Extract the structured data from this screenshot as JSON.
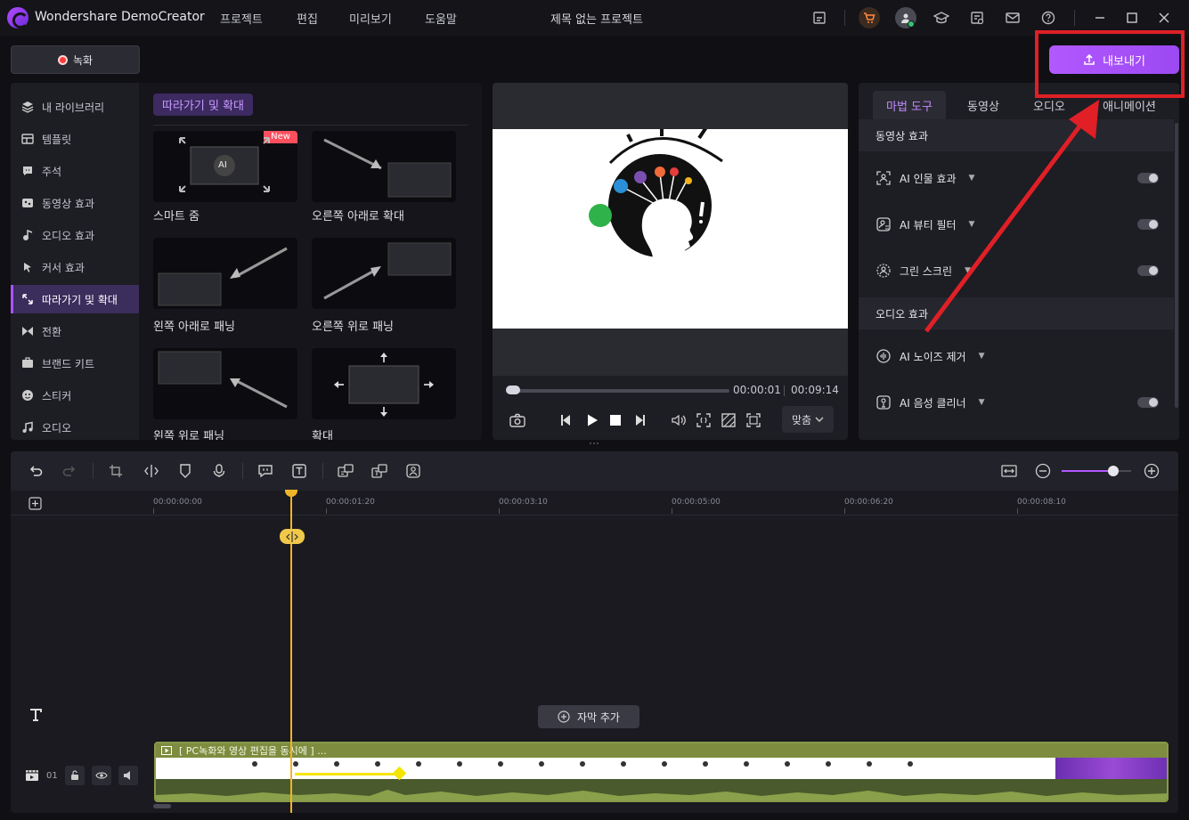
{
  "app": {
    "name": "Wondershare DemoCreator",
    "project_title": "제목 없는 프로젝트",
    "menu": [
      "프로젝트",
      "편집",
      "미리보기",
      "도움말"
    ]
  },
  "toolbar": {
    "record_label": "녹화",
    "export_label": "내보내기",
    "icons": [
      "feedback-icon",
      "cart-icon",
      "account-icon",
      "tutorial-icon",
      "tools-icon",
      "mail-icon",
      "help-icon",
      "minimize-icon",
      "maximize-icon",
      "close-icon"
    ]
  },
  "sidebar": {
    "items": [
      {
        "label": "내 라이브러리",
        "icon": "layers-icon"
      },
      {
        "label": "템플릿",
        "icon": "template-icon"
      },
      {
        "label": "주석",
        "icon": "annotation-icon"
      },
      {
        "label": "동영상 효과",
        "icon": "video-effect-icon"
      },
      {
        "label": "오디오 효과",
        "icon": "audio-effect-icon"
      },
      {
        "label": "커서 효과",
        "icon": "cursor-icon"
      },
      {
        "label": "따라가기 및 확대",
        "icon": "zoom-pan-icon",
        "active": true
      },
      {
        "label": "전환",
        "icon": "transition-icon"
      },
      {
        "label": "브랜드 키트",
        "icon": "brand-kit-icon"
      },
      {
        "label": "스티커",
        "icon": "sticker-icon"
      },
      {
        "label": "오디오",
        "icon": "music-icon"
      }
    ]
  },
  "library": {
    "section_title": "따라가기 및 확대",
    "new_badge": "New",
    "items": [
      {
        "label": "스마트 줌"
      },
      {
        "label": "오른쪽 아래로 확대"
      },
      {
        "label": "왼쪽 아래로 패닝"
      },
      {
        "label": "오른쪽 위로 패닝"
      },
      {
        "label": "왼쪽 위로 패닝"
      },
      {
        "label": "확대"
      }
    ],
    "ai_label": "AI"
  },
  "preview": {
    "current_time": "00:00:01",
    "total_time": "00:09:14",
    "progress": 0.01,
    "fit_label": "맞춤"
  },
  "right_panel": {
    "tabs": [
      "마법 도구",
      "동영상",
      "오디오",
      "애니메이션"
    ],
    "active_tab": 0,
    "video_section": "동영상 효과",
    "video_effects": [
      {
        "label": "AI 인물 효과",
        "icon": "person-frame-icon",
        "enabled": false
      },
      {
        "label": "AI 뷰티 필터",
        "icon": "beauty-icon",
        "enabled": false
      },
      {
        "label": "그린 스크린",
        "icon": "green-screen-icon",
        "enabled": false
      }
    ],
    "audio_section": "오디오 효과",
    "audio_effects": [
      {
        "label": "AI 노이즈 제거",
        "icon": "noise-icon",
        "enabled": false
      },
      {
        "label": "AI 음성 클리너",
        "icon": "voice-clean-icon",
        "enabled": false
      }
    ]
  },
  "timeline": {
    "ruler": [
      "00:00:00:00",
      "00:00:01:20",
      "00:00:03:10",
      "00:00:05:00",
      "00:00:06:20",
      "00:00:08:10"
    ],
    "add_subtitle_label": "자막 추가",
    "track_number": "01",
    "clip_title": "[ PC녹화와 영상 편집을 동시에 ] ...",
    "zoom_level": 0.75
  },
  "colors": {
    "accent": "#a855f7",
    "export_gradient_start": "#b258ff",
    "annotation_red": "#e01f26",
    "playhead": "#f0b429",
    "clip_green": "#7d8c3e"
  }
}
